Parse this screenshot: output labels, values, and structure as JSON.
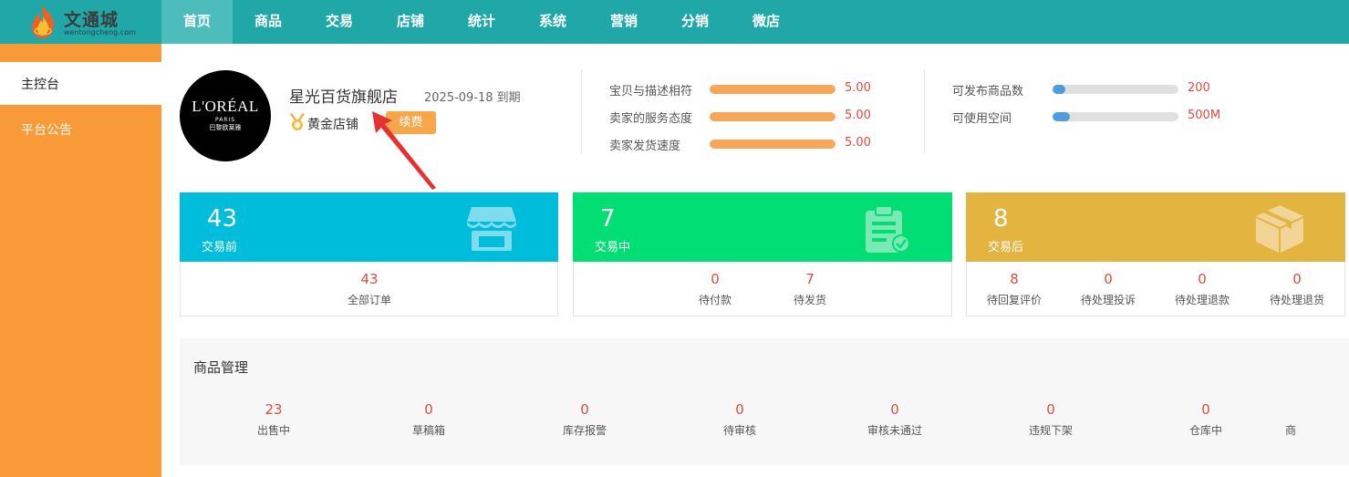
{
  "brand": {
    "name": "文通城",
    "domain": "wentongcheng.com"
  },
  "nav": [
    {
      "label": "首页",
      "active": true
    },
    {
      "label": "商品"
    },
    {
      "label": "交易"
    },
    {
      "label": "店铺"
    },
    {
      "label": "统计"
    },
    {
      "label": "系统"
    },
    {
      "label": "营销"
    },
    {
      "label": "分销"
    },
    {
      "label": "微店"
    }
  ],
  "sidebar": [
    {
      "label": "主控台",
      "active": true
    },
    {
      "label": "平台公告"
    }
  ],
  "store": {
    "logo": {
      "line1": "L'ORÉAL",
      "line2": "PARIS",
      "line3": "巴黎欧莱雅"
    },
    "name": "星光百货旗舰店",
    "expire": "2025-09-18 到期",
    "level": "黄金店铺",
    "renew_label": "续费"
  },
  "ratings": [
    {
      "label": "宝贝与描述相符",
      "value": "5.00",
      "fill": 1.0
    },
    {
      "label": "卖家的服务态度",
      "value": "5.00",
      "fill": 1.0
    },
    {
      "label": "卖家发货速度",
      "value": "5.00",
      "fill": 1.0
    }
  ],
  "quotas": [
    {
      "label": "可发布商品数",
      "value": "200",
      "fill": 0.1
    },
    {
      "label": "可使用空间",
      "value": "500M",
      "fill": 0.14
    }
  ],
  "cards": [
    {
      "count": "43",
      "caption": "交易前",
      "color": "#00bddc",
      "items": [
        {
          "value": "43",
          "label": "全部订单"
        }
      ]
    },
    {
      "count": "7",
      "caption": "交易中",
      "color": "#00de74",
      "items": [
        {
          "value": "0",
          "label": "待付款"
        },
        {
          "value": "7",
          "label": "待发货"
        }
      ]
    },
    {
      "count": "8",
      "caption": "交易后",
      "color": "#e3b440",
      "items": [
        {
          "value": "8",
          "label": "待回复评价"
        },
        {
          "value": "0",
          "label": "待处理投诉"
        },
        {
          "value": "0",
          "label": "待处理退款"
        },
        {
          "value": "0",
          "label": "待处理退货"
        }
      ]
    }
  ],
  "goods": {
    "title": "商品管理",
    "items": [
      {
        "value": "23",
        "label": "出售中"
      },
      {
        "value": "0",
        "label": "草稿箱"
      },
      {
        "value": "0",
        "label": "库存报警"
      },
      {
        "value": "0",
        "label": "待审核"
      },
      {
        "value": "0",
        "label": "审核未通过"
      },
      {
        "value": "0",
        "label": "违规下架"
      },
      {
        "value": "0",
        "label": "仓库中"
      },
      {
        "value": "",
        "label": "商"
      }
    ]
  }
}
